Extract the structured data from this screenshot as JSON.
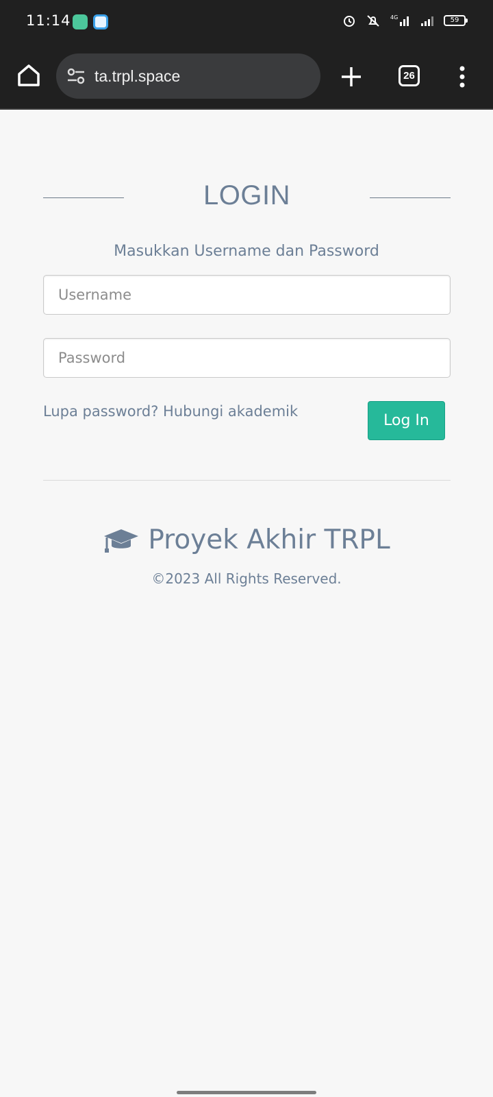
{
  "status_bar": {
    "time": "11:14",
    "battery": "59",
    "network": "4G"
  },
  "browser": {
    "url": "ta.trpl.space",
    "tab_count": "26"
  },
  "login": {
    "title": "LOGIN",
    "subtitle": "Masukkan Username dan Password",
    "username_placeholder": "Username",
    "password_placeholder": "Password",
    "forgot_text": "Lupa password? Hubungi akademik",
    "submit_label": "Log In"
  },
  "footer": {
    "brand": "Proyek Akhir TRPL",
    "copyright": "©2023 All Rights Reserved."
  },
  "colors": {
    "accent": "#26b99a",
    "text": "#6c7f96",
    "background": "#f7f7f7"
  }
}
